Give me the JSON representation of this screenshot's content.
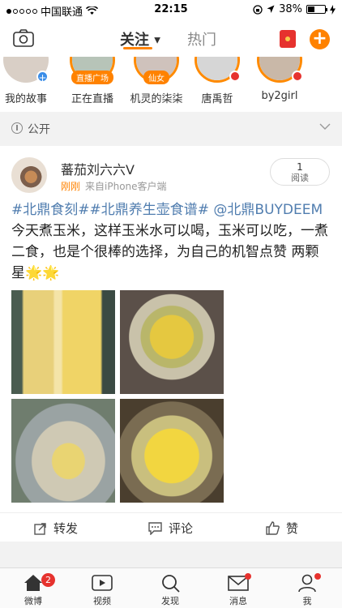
{
  "status_bar": {
    "carrier": "中国联通",
    "time": "22:15",
    "battery": "38%"
  },
  "top_nav": {
    "tab_follow": "关注",
    "tab_hot": "热门"
  },
  "stories": [
    {
      "name": "我的故事",
      "badge": ""
    },
    {
      "name": "正在直播",
      "badge": "直播广场"
    },
    {
      "name": "机灵的柒柒",
      "badge": "仙女"
    },
    {
      "name": "唐禹哲",
      "badge": ""
    },
    {
      "name": "by2girl",
      "badge": ""
    }
  ],
  "visibility": {
    "label": "公开"
  },
  "post": {
    "username": "蕃茄刘六六",
    "verified": "V",
    "time": "刚刚",
    "source": "来自iPhone客户端",
    "read_count": "1",
    "read_label": "阅读",
    "topic1": "#北鼎食刻#",
    "topic2": "#北鼎养生壶食谱#",
    "mention": "@北鼎BUYDEEM",
    "text": " 今天煮玉米，这样玉米水可以喝，玉米可以吃，一煮二食，也是个很棒的选择，为自己的机智点赞 两颗星",
    "stars": "🌟🌟"
  },
  "actions": {
    "repost": "转发",
    "comment": "评论",
    "like": "赞"
  },
  "tab_bar": {
    "weibo": "微博",
    "weibo_badge": "2",
    "video": "视频",
    "discover": "发现",
    "messages": "消息",
    "me": "我"
  }
}
